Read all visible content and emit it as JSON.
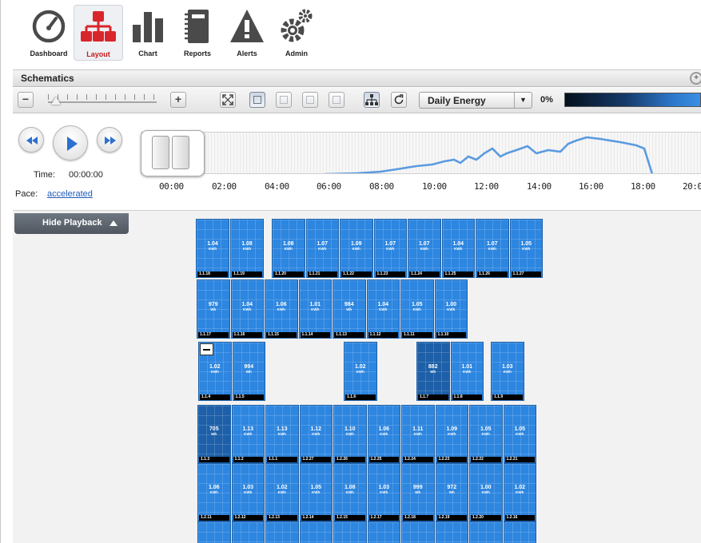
{
  "nav": [
    {
      "label": "Dashboard",
      "icon": "gauge-icon"
    },
    {
      "label": "Layout",
      "icon": "sitemap-icon",
      "active": true
    },
    {
      "label": "Chart",
      "icon": "bar-chart-icon"
    },
    {
      "label": "Reports",
      "icon": "notebook-icon"
    },
    {
      "label": "Alerts",
      "icon": "warning-icon"
    },
    {
      "label": "Admin",
      "icon": "gears-icon"
    }
  ],
  "schematics": {
    "title": "Schematics"
  },
  "toolbar": {
    "zoom_out_label": "−",
    "zoom_in_label": "+",
    "metric": "Daily Energy",
    "percent": "0%",
    "gradient_colors": [
      "#06101c",
      "#153a6a",
      "#2c78cc",
      "#3b8fe3"
    ]
  },
  "playback": {
    "time_label": "Time:",
    "time_value": "00:00:00",
    "pace_label": "Pace:",
    "pace_value": "accelerated",
    "ticks": [
      "00:00",
      "02:00",
      "04:00",
      "06:00",
      "08:00",
      "10:00",
      "12:00",
      "14:00",
      "16:00",
      "18:00",
      "20:0"
    ],
    "hide_label": "Hide Playback",
    "curve_color": "#5a9be0"
  },
  "panels": {
    "row1a": [
      {
        "id": "1.1.18",
        "value": "1.04",
        "unit": "KWh"
      },
      {
        "id": "1.1.19",
        "value": "1.08",
        "unit": "KWh"
      }
    ],
    "row1b": [
      {
        "id": "1.1.20",
        "value": "1.08",
        "unit": "KWh"
      },
      {
        "id": "1.1.21",
        "value": "1.07",
        "unit": "KWh"
      },
      {
        "id": "1.1.22",
        "value": "1.09",
        "unit": "KWh"
      },
      {
        "id": "1.1.23",
        "value": "1.07",
        "unit": "KWh"
      },
      {
        "id": "1.1.24",
        "value": "1.07",
        "unit": "KWh"
      },
      {
        "id": "1.1.25",
        "value": "1.04",
        "unit": "KWh"
      },
      {
        "id": "1.1.26",
        "value": "1.07",
        "unit": "KWh"
      },
      {
        "id": "1.1.27",
        "value": "1.05",
        "unit": "KWh"
      }
    ],
    "row2": [
      {
        "id": "1.1.17",
        "value": "979",
        "unit": "Wh"
      },
      {
        "id": "1.1.16",
        "value": "1.04",
        "unit": "KWh"
      },
      {
        "id": "1.1.15",
        "value": "1.06",
        "unit": "KWh"
      },
      {
        "id": "1.1.14",
        "value": "1.01",
        "unit": "KWh"
      },
      {
        "id": "1.1.13",
        "value": "984",
        "unit": "Wh"
      },
      {
        "id": "1.1.12",
        "value": "1.04",
        "unit": "KWh"
      },
      {
        "id": "1.1.11",
        "value": "1.05",
        "unit": "KWh"
      },
      {
        "id": "1.1.10",
        "value": "1.00",
        "unit": "KWh"
      }
    ],
    "row3a": [
      {
        "id": "1.1.4",
        "value": "1.02",
        "unit": "KWh"
      },
      {
        "id": "1.1.5",
        "value": "994",
        "unit": "Wh"
      }
    ],
    "row3b": [
      {
        "id": "1.1.6",
        "value": "1.02",
        "unit": "KWh"
      }
    ],
    "row3c": [
      {
        "id": "1.1.7",
        "value": "882",
        "unit": "Wh"
      },
      {
        "id": "1.1.8",
        "value": "1.01",
        "unit": "KWh"
      }
    ],
    "row3d": [
      {
        "id": "1.1.9",
        "value": "1.03",
        "unit": "KWh"
      }
    ],
    "row4": [
      {
        "id": "1.1.3",
        "value": "705",
        "unit": "Wh"
      },
      {
        "id": "1.1.2",
        "value": "1.13",
        "unit": "KWh"
      },
      {
        "id": "1.1.1",
        "value": "1.13",
        "unit": "KWh"
      },
      {
        "id": "1.2.27",
        "value": "1.12",
        "unit": "KWh"
      },
      {
        "id": "1.2.26",
        "value": "1.10",
        "unit": "KWh"
      },
      {
        "id": "1.2.25",
        "value": "1.06",
        "unit": "KWh"
      },
      {
        "id": "1.2.24",
        "value": "1.11",
        "unit": "KWh"
      },
      {
        "id": "1.2.23",
        "value": "1.09",
        "unit": "KWh"
      },
      {
        "id": "1.2.22",
        "value": "1.05",
        "unit": "KWh"
      },
      {
        "id": "1.2.21",
        "value": "1.05",
        "unit": "KWh"
      }
    ],
    "row5": [
      {
        "id": "1.2.11",
        "value": "1.06",
        "unit": "KWh"
      },
      {
        "id": "1.2.12",
        "value": "1.03",
        "unit": "KWh"
      },
      {
        "id": "1.2.13",
        "value": "1.02",
        "unit": "KWh"
      },
      {
        "id": "1.2.14",
        "value": "1.05",
        "unit": "KWh"
      },
      {
        "id": "1.2.15",
        "value": "1.08",
        "unit": "KWh"
      },
      {
        "id": "1.2.17",
        "value": "1.03",
        "unit": "KWh"
      },
      {
        "id": "1.2.18",
        "value": "999",
        "unit": "Wh"
      },
      {
        "id": "1.2.19",
        "value": "972",
        "unit": "Wh"
      },
      {
        "id": "1.2.20",
        "value": "1.00",
        "unit": "KWh"
      },
      {
        "id": "1.2.16",
        "value": "1.02",
        "unit": "KWh"
      }
    ]
  }
}
